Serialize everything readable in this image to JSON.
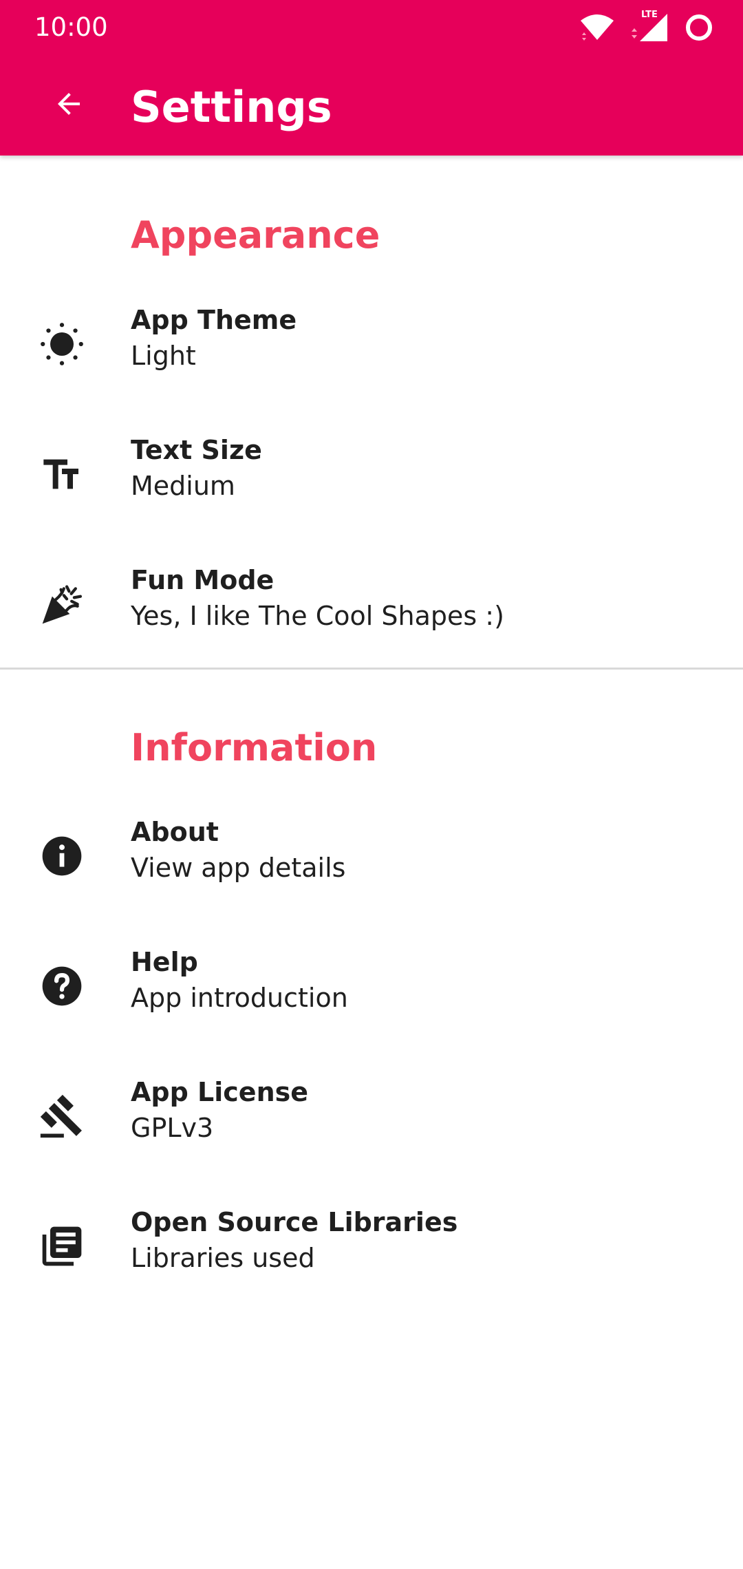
{
  "status_bar": {
    "time": "10:00",
    "network_label": "LTE"
  },
  "app_bar": {
    "title": "Settings",
    "back_icon": "arrow-back-icon",
    "background_color": "#e6005a"
  },
  "sections": [
    {
      "header": "Appearance",
      "items": [
        {
          "title": "App Theme",
          "subtitle": "Light",
          "icon": "sun-icon"
        },
        {
          "title": "Text Size",
          "subtitle": "Medium",
          "icon": "text-size-icon"
        },
        {
          "title": "Fun Mode",
          "subtitle": "Yes, I like The Cool Shapes :)",
          "icon": "party-popper-icon"
        }
      ]
    },
    {
      "header": "Information",
      "items": [
        {
          "title": "About",
          "subtitle": "View app details",
          "icon": "info-icon"
        },
        {
          "title": "Help",
          "subtitle": "App introduction",
          "icon": "help-icon"
        },
        {
          "title": "App License",
          "subtitle": "GPLv3",
          "icon": "gavel-icon"
        },
        {
          "title": "Open Source Libraries",
          "subtitle": "Libraries used",
          "icon": "library-books-icon"
        }
      ]
    }
  ],
  "colors": {
    "accent": "#f0445e",
    "text": "#1f1f1f",
    "divider": "#d9d9d9"
  }
}
